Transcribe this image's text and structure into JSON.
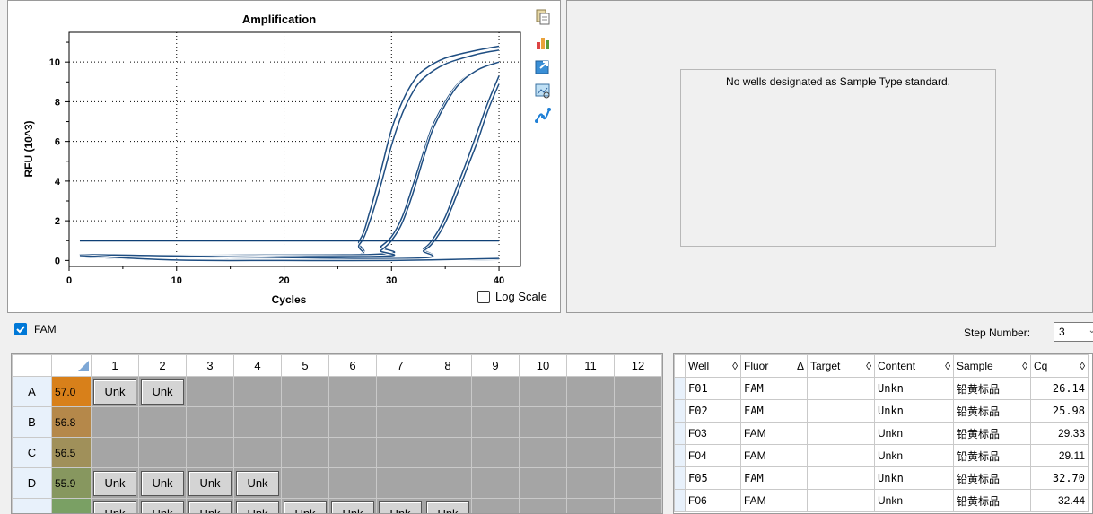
{
  "chart": {
    "title": "Amplification",
    "xlabel": "Cycles",
    "ylabel": "RFU (10^3)",
    "log_scale_label": "Log Scale",
    "x_ticks": [
      "0",
      "10",
      "20",
      "30",
      "40"
    ],
    "y_ticks": [
      "0",
      "2",
      "4",
      "6",
      "8",
      "10"
    ]
  },
  "chart_data": {
    "type": "line",
    "title": "Amplification",
    "xlabel": "Cycles",
    "ylabel": "RFU (10^3)",
    "xlim": [
      0,
      42
    ],
    "ylim": [
      -0.3,
      11.5
    ],
    "grid": true,
    "threshold": 1.0,
    "series": [
      {
        "x": [
          1,
          25,
          27,
          28,
          29,
          30,
          31,
          32,
          33,
          35,
          38,
          40
        ],
        "y": [
          0.3,
          0.2,
          1.0,
          2.5,
          4.5,
          6.6,
          8.0,
          9.0,
          9.6,
          10.2,
          10.6,
          10.8
        ]
      },
      {
        "x": [
          1,
          25,
          27,
          28,
          29,
          30,
          31,
          32,
          33,
          35,
          38,
          40
        ],
        "y": [
          0.3,
          0.1,
          0.8,
          2.0,
          3.8,
          5.8,
          7.4,
          8.5,
          9.2,
          9.9,
          10.4,
          10.6
        ]
      },
      {
        "x": [
          1,
          28,
          29,
          30,
          31,
          32,
          33,
          34,
          36,
          38,
          40
        ],
        "y": [
          0.3,
          0.3,
          0.7,
          1.2,
          2.2,
          3.8,
          5.5,
          7.0,
          8.8,
          9.6,
          10.0
        ]
      },
      {
        "x": [
          1,
          28,
          29,
          30,
          31,
          32,
          33,
          34,
          36,
          38,
          40
        ],
        "y": [
          0.3,
          0.2,
          0.5,
          1.0,
          1.9,
          3.4,
          5.2,
          6.8,
          8.7,
          9.6,
          10.0
        ]
      },
      {
        "x": [
          1,
          31,
          33,
          34,
          35,
          36,
          37,
          38,
          39,
          40
        ],
        "y": [
          0.3,
          0.1,
          0.6,
          1.2,
          2.2,
          3.6,
          5.0,
          6.5,
          8.0,
          9.3
        ]
      },
      {
        "x": [
          1,
          31,
          33,
          34,
          35,
          36,
          37,
          38,
          39,
          40
        ],
        "y": [
          0.3,
          0.1,
          0.5,
          1.0,
          1.9,
          3.2,
          4.6,
          6.0,
          7.6,
          8.9
        ]
      },
      {
        "x": [
          1,
          10,
          20,
          30,
          40
        ],
        "y": [
          0.2,
          0.0,
          0.0,
          0.0,
          0.05
        ]
      },
      {
        "x": [
          1,
          10,
          20,
          30,
          40
        ],
        "y": [
          0.25,
          0.02,
          0.0,
          0.0,
          0.1
        ]
      }
    ]
  },
  "standard_curve": {
    "message": "No wells designated as Sample Type standard."
  },
  "fluor_bar": {
    "fam_label": "FAM",
    "step_label": "Step Number:",
    "step_value": "3"
  },
  "plate": {
    "columns": [
      "1",
      "2",
      "3",
      "4",
      "5",
      "6",
      "7",
      "8",
      "9",
      "10",
      "11",
      "12"
    ],
    "rows": [
      {
        "label": "A",
        "temp": "57.0",
        "temp_color": "#d8801a",
        "wells": [
          "Unk",
          "Unk",
          "",
          "",
          "",
          "",
          "",
          "",
          "",
          "",
          "",
          ""
        ]
      },
      {
        "label": "B",
        "temp": "56.8",
        "temp_color": "#b5884a",
        "wells": [
          "",
          "",
          "",
          "",
          "",
          "",
          "",
          "",
          "",
          "",
          "",
          ""
        ]
      },
      {
        "label": "C",
        "temp": "56.5",
        "temp_color": "#a0905a",
        "wells": [
          "",
          "",
          "",
          "",
          "",
          "",
          "",
          "",
          "",
          "",
          "",
          ""
        ]
      },
      {
        "label": "D",
        "temp": "55.9",
        "temp_color": "#87975f",
        "wells": [
          "Unk",
          "Unk",
          "Unk",
          "Unk",
          "",
          "",
          "",
          "",
          "",
          "",
          "",
          ""
        ]
      },
      {
        "label": "",
        "temp": "",
        "temp_color": "#7aa064",
        "wells": [
          "Unk",
          "Unk",
          "Unk",
          "Unk",
          "Unk",
          "Unk",
          "Unk",
          "Unk",
          "",
          "",
          "",
          ""
        ]
      }
    ]
  },
  "results": {
    "headers": [
      {
        "label": "Well",
        "sort": "◊"
      },
      {
        "label": "Fluor",
        "sort": "Δ"
      },
      {
        "label": "Target",
        "sort": "◊"
      },
      {
        "label": "Content",
        "sort": "◊"
      },
      {
        "label": "Sample",
        "sort": "◊"
      },
      {
        "label": "Cq",
        "sort": "◊"
      }
    ],
    "rows": [
      {
        "well": "F01",
        "fluor": "FAM",
        "target": "",
        "content": "Unkn",
        "sample": "铅黄标品",
        "cq": "26.14",
        "mono": true
      },
      {
        "well": "F02",
        "fluor": "FAM",
        "target": "",
        "content": "Unkn",
        "sample": "铅黄标品",
        "cq": "25.98",
        "mono": true
      },
      {
        "well": "F03",
        "fluor": "FAM",
        "target": "",
        "content": "Unkn",
        "sample": "铅黄标品",
        "cq": "29.33",
        "mono": false
      },
      {
        "well": "F04",
        "fluor": "FAM",
        "target": "",
        "content": "Unkn",
        "sample": "铅黄标品",
        "cq": "29.11",
        "mono": false
      },
      {
        "well": "F05",
        "fluor": "FAM",
        "target": "",
        "content": "Unkn",
        "sample": "铅黄标品",
        "cq": "32.70",
        "mono": true
      },
      {
        "well": "F06",
        "fluor": "FAM",
        "target": "",
        "content": "Unkn",
        "sample": "铅黄标品",
        "cq": "32.44",
        "mono": false
      }
    ]
  }
}
